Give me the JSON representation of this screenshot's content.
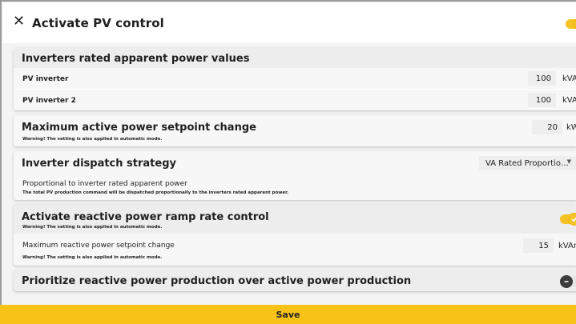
{
  "header": {
    "title": "Activate PV control",
    "close_icon": "close-icon",
    "toggle_state": "on"
  },
  "inverters": {
    "title": "Inverters rated apparent power values",
    "rows": [
      {
        "label": "PV inverter",
        "value": "100",
        "unit": "kVA"
      },
      {
        "label": "PV inverter 2",
        "value": "100",
        "unit": "kVA"
      }
    ]
  },
  "max_active": {
    "title": "Maximum active power setpoint change",
    "warning": "Warning! The setting is also applied in automatic mode.",
    "value": "20",
    "unit": "kW"
  },
  "dispatch": {
    "title": "Inverter dispatch strategy",
    "select_value": "VA Rated Proportio…",
    "subtitle": "Proportional to inverter rated apparent power",
    "description": "The total PV production command will be dispatched proportionally to the inverters rated apparent power."
  },
  "reactive_ramp": {
    "title": "Activate reactive power ramp rate control",
    "warning": "Warning! The setting is also applied in automatic mode.",
    "toggle_state": "on",
    "sub_label": "Maximum reactive power setpoint change",
    "sub_warning": "Warning! The setting is also applied in automatic mode.",
    "value": "15",
    "unit": "kVAr"
  },
  "prioritize": {
    "title": "Prioritize reactive power production over active power production",
    "toggle_state": "off"
  },
  "save_label": "Save",
  "colors": {
    "accent": "#f8c219",
    "toggle_on": "#f5c327"
  }
}
